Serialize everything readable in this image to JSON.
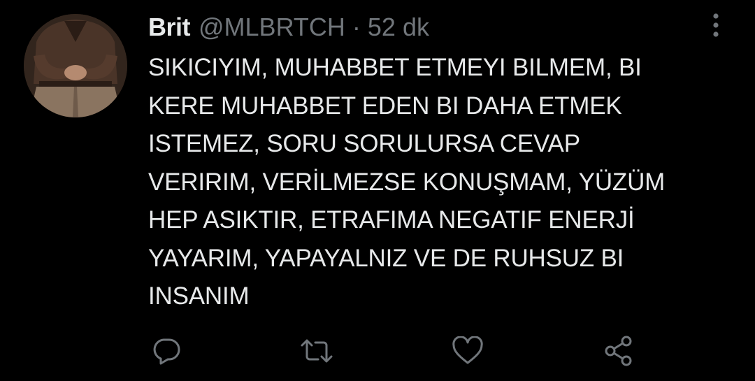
{
  "tweet": {
    "display_name": "Brit",
    "handle": "@MLBRTCH",
    "separator": "·",
    "time": "52 dk",
    "text": "SIKICIYIM, MUHABBET ETMEYI BILMEM, BI\nKERE MUHABBET EDEN BI DAHA ETMEK\nISTEMEZ, SORU SORULURSA CEVAP\nVERIRIM, VERİLMEZSE KONUŞMAM, YÜZÜM\nHEP ASIKTIR, ETRAFIMA NEGATIF ENERJİ\nYAYARIM, YAPAYALNIZ VE DE RUHSUZ BI\nINSANIM"
  },
  "icons": {
    "more": "more-vertical-icon",
    "reply": "reply-bubble-icon",
    "retweet": "retweet-icon",
    "like": "heart-icon",
    "share": "share-icon"
  },
  "colors": {
    "background": "#000000",
    "text_primary": "#e7e9ea",
    "text_secondary": "#71767b"
  }
}
